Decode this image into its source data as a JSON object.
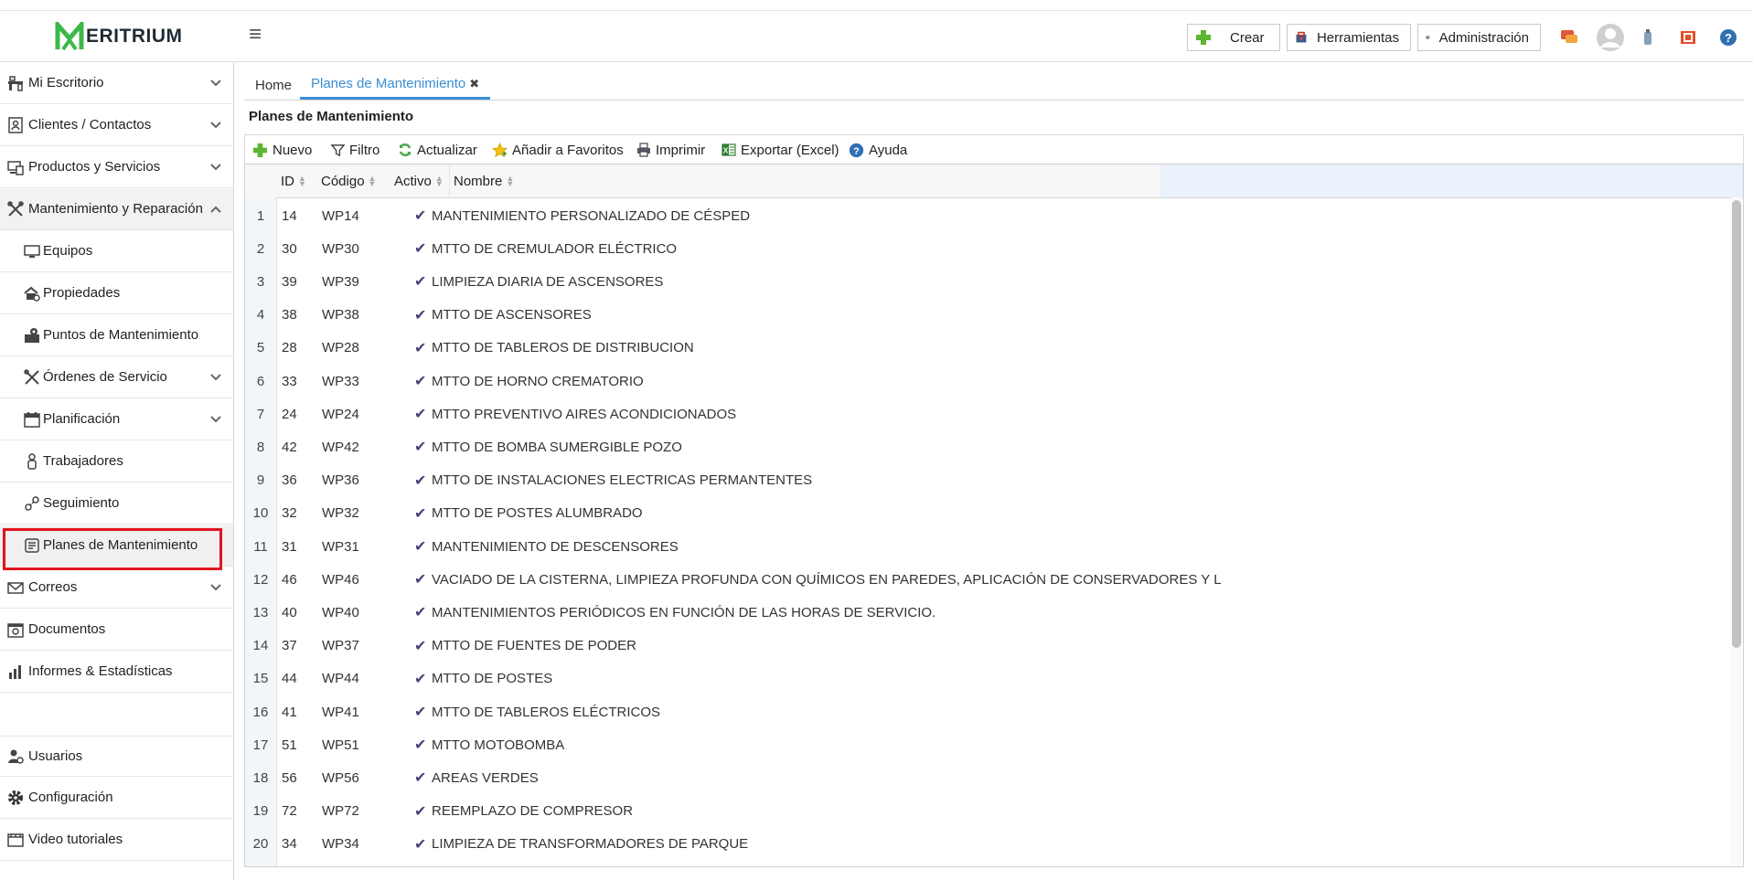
{
  "header": {
    "logo_letter": "M",
    "logo_text": "ERITRIUM",
    "buttons": {
      "create": "Crear",
      "tools": "Herramientas",
      "admin": "Administración"
    }
  },
  "sidebar": {
    "items": [
      {
        "label": "Mi Escritorio"
      },
      {
        "label": "Clientes / Contactos"
      },
      {
        "label": "Productos y Servicios"
      },
      {
        "label": "Mantenimiento y Reparación"
      },
      {
        "label": "Equipos"
      },
      {
        "label": "Propiedades"
      },
      {
        "label": "Puntos de Mantenimiento"
      },
      {
        "label": "Órdenes de Servicio"
      },
      {
        "label": "Planificación"
      },
      {
        "label": "Trabajadores"
      },
      {
        "label": "Seguimiento"
      },
      {
        "label": "Planes de Mantenimiento"
      },
      {
        "label": "Correos"
      },
      {
        "label": "Documentos"
      },
      {
        "label": "Informes & Estadísticas"
      },
      {
        "label": "Usuarios"
      },
      {
        "label": "Configuración"
      },
      {
        "label": "Video tutoriales"
      }
    ]
  },
  "tabs": {
    "home": "Home",
    "active": "Planes de Mantenimiento",
    "close": "✖"
  },
  "page": {
    "title": "Planes de Mantenimiento"
  },
  "toolbar": {
    "new": "Nuevo",
    "filter": "Filtro",
    "refresh": "Actualizar",
    "favorites": "Añadir a Favoritos",
    "print": "Imprimir",
    "export": "Exportar (Excel)",
    "help": "Ayuda"
  },
  "grid": {
    "columns": {
      "id": "ID",
      "code": "Código",
      "active": "Activo",
      "name": "Nombre"
    },
    "check": "✔",
    "rows": [
      {
        "n": "1",
        "id": "14",
        "code": "WP14",
        "name": "MANTENIMIENTO PERSONALIZADO DE CÉSPED"
      },
      {
        "n": "2",
        "id": "30",
        "code": "WP30",
        "name": "MTTO DE CREMULADOR ELÉCTRICO"
      },
      {
        "n": "3",
        "id": "39",
        "code": "WP39",
        "name": "LIMPIEZA DIARIA DE ASCENSORES"
      },
      {
        "n": "4",
        "id": "38",
        "code": "WP38",
        "name": "MTTO DE ASCENSORES"
      },
      {
        "n": "5",
        "id": "28",
        "code": "WP28",
        "name": "MTTO DE TABLEROS DE DISTRIBUCION"
      },
      {
        "n": "6",
        "id": "33",
        "code": "WP33",
        "name": "MTTO DE HORNO CREMATORIO"
      },
      {
        "n": "7",
        "id": "24",
        "code": "WP24",
        "name": "MTTO PREVENTIVO AIRES ACONDICIONADOS"
      },
      {
        "n": "8",
        "id": "42",
        "code": "WP42",
        "name": "MTTO DE BOMBA SUMERGIBLE POZO"
      },
      {
        "n": "9",
        "id": "36",
        "code": "WP36",
        "name": "MTTO DE INSTALACIONES ELECTRICAS PERMANTENTES"
      },
      {
        "n": "10",
        "id": "32",
        "code": "WP32",
        "name": "MTTO DE POSTES ALUMBRADO"
      },
      {
        "n": "11",
        "id": "31",
        "code": "WP31",
        "name": "MANTENIMIENTO DE DESCENSORES"
      },
      {
        "n": "12",
        "id": "46",
        "code": "WP46",
        "name": "VACIADO DE LA CISTERNA, LIMPIEZA PROFUNDA CON QUÍMICOS EN PAREDES, APLICACIÓN DE CONSERVADORES Y L"
      },
      {
        "n": "13",
        "id": "40",
        "code": "WP40",
        "name": "MANTENIMIENTOS PERIÓDICOS EN FUNCIÓN DE LAS HORAS DE SERVICIO."
      },
      {
        "n": "14",
        "id": "37",
        "code": "WP37",
        "name": "MTTO DE FUENTES DE PODER"
      },
      {
        "n": "15",
        "id": "44",
        "code": "WP44",
        "name": "MTTO DE POSTES"
      },
      {
        "n": "16",
        "id": "41",
        "code": "WP41",
        "name": "MTTO DE TABLEROS ELÉCTRICOS"
      },
      {
        "n": "17",
        "id": "51",
        "code": "WP51",
        "name": "MTTO MOTOBOMBA"
      },
      {
        "n": "18",
        "id": "56",
        "code": "WP56",
        "name": "AREAS VERDES"
      },
      {
        "n": "19",
        "id": "72",
        "code": "WP72",
        "name": "REEMPLAZO DE COMPRESOR"
      },
      {
        "n": "20",
        "id": "34",
        "code": "WP34",
        "name": "LIMPIEZA DE TRANSFORMADORES DE PARQUE"
      }
    ]
  },
  "colors": {
    "brand_green": "#3db84a",
    "accent_blue": "#3a8ed6",
    "highlight_red": "#e0141e",
    "check_purple": "#4b3f7a"
  }
}
